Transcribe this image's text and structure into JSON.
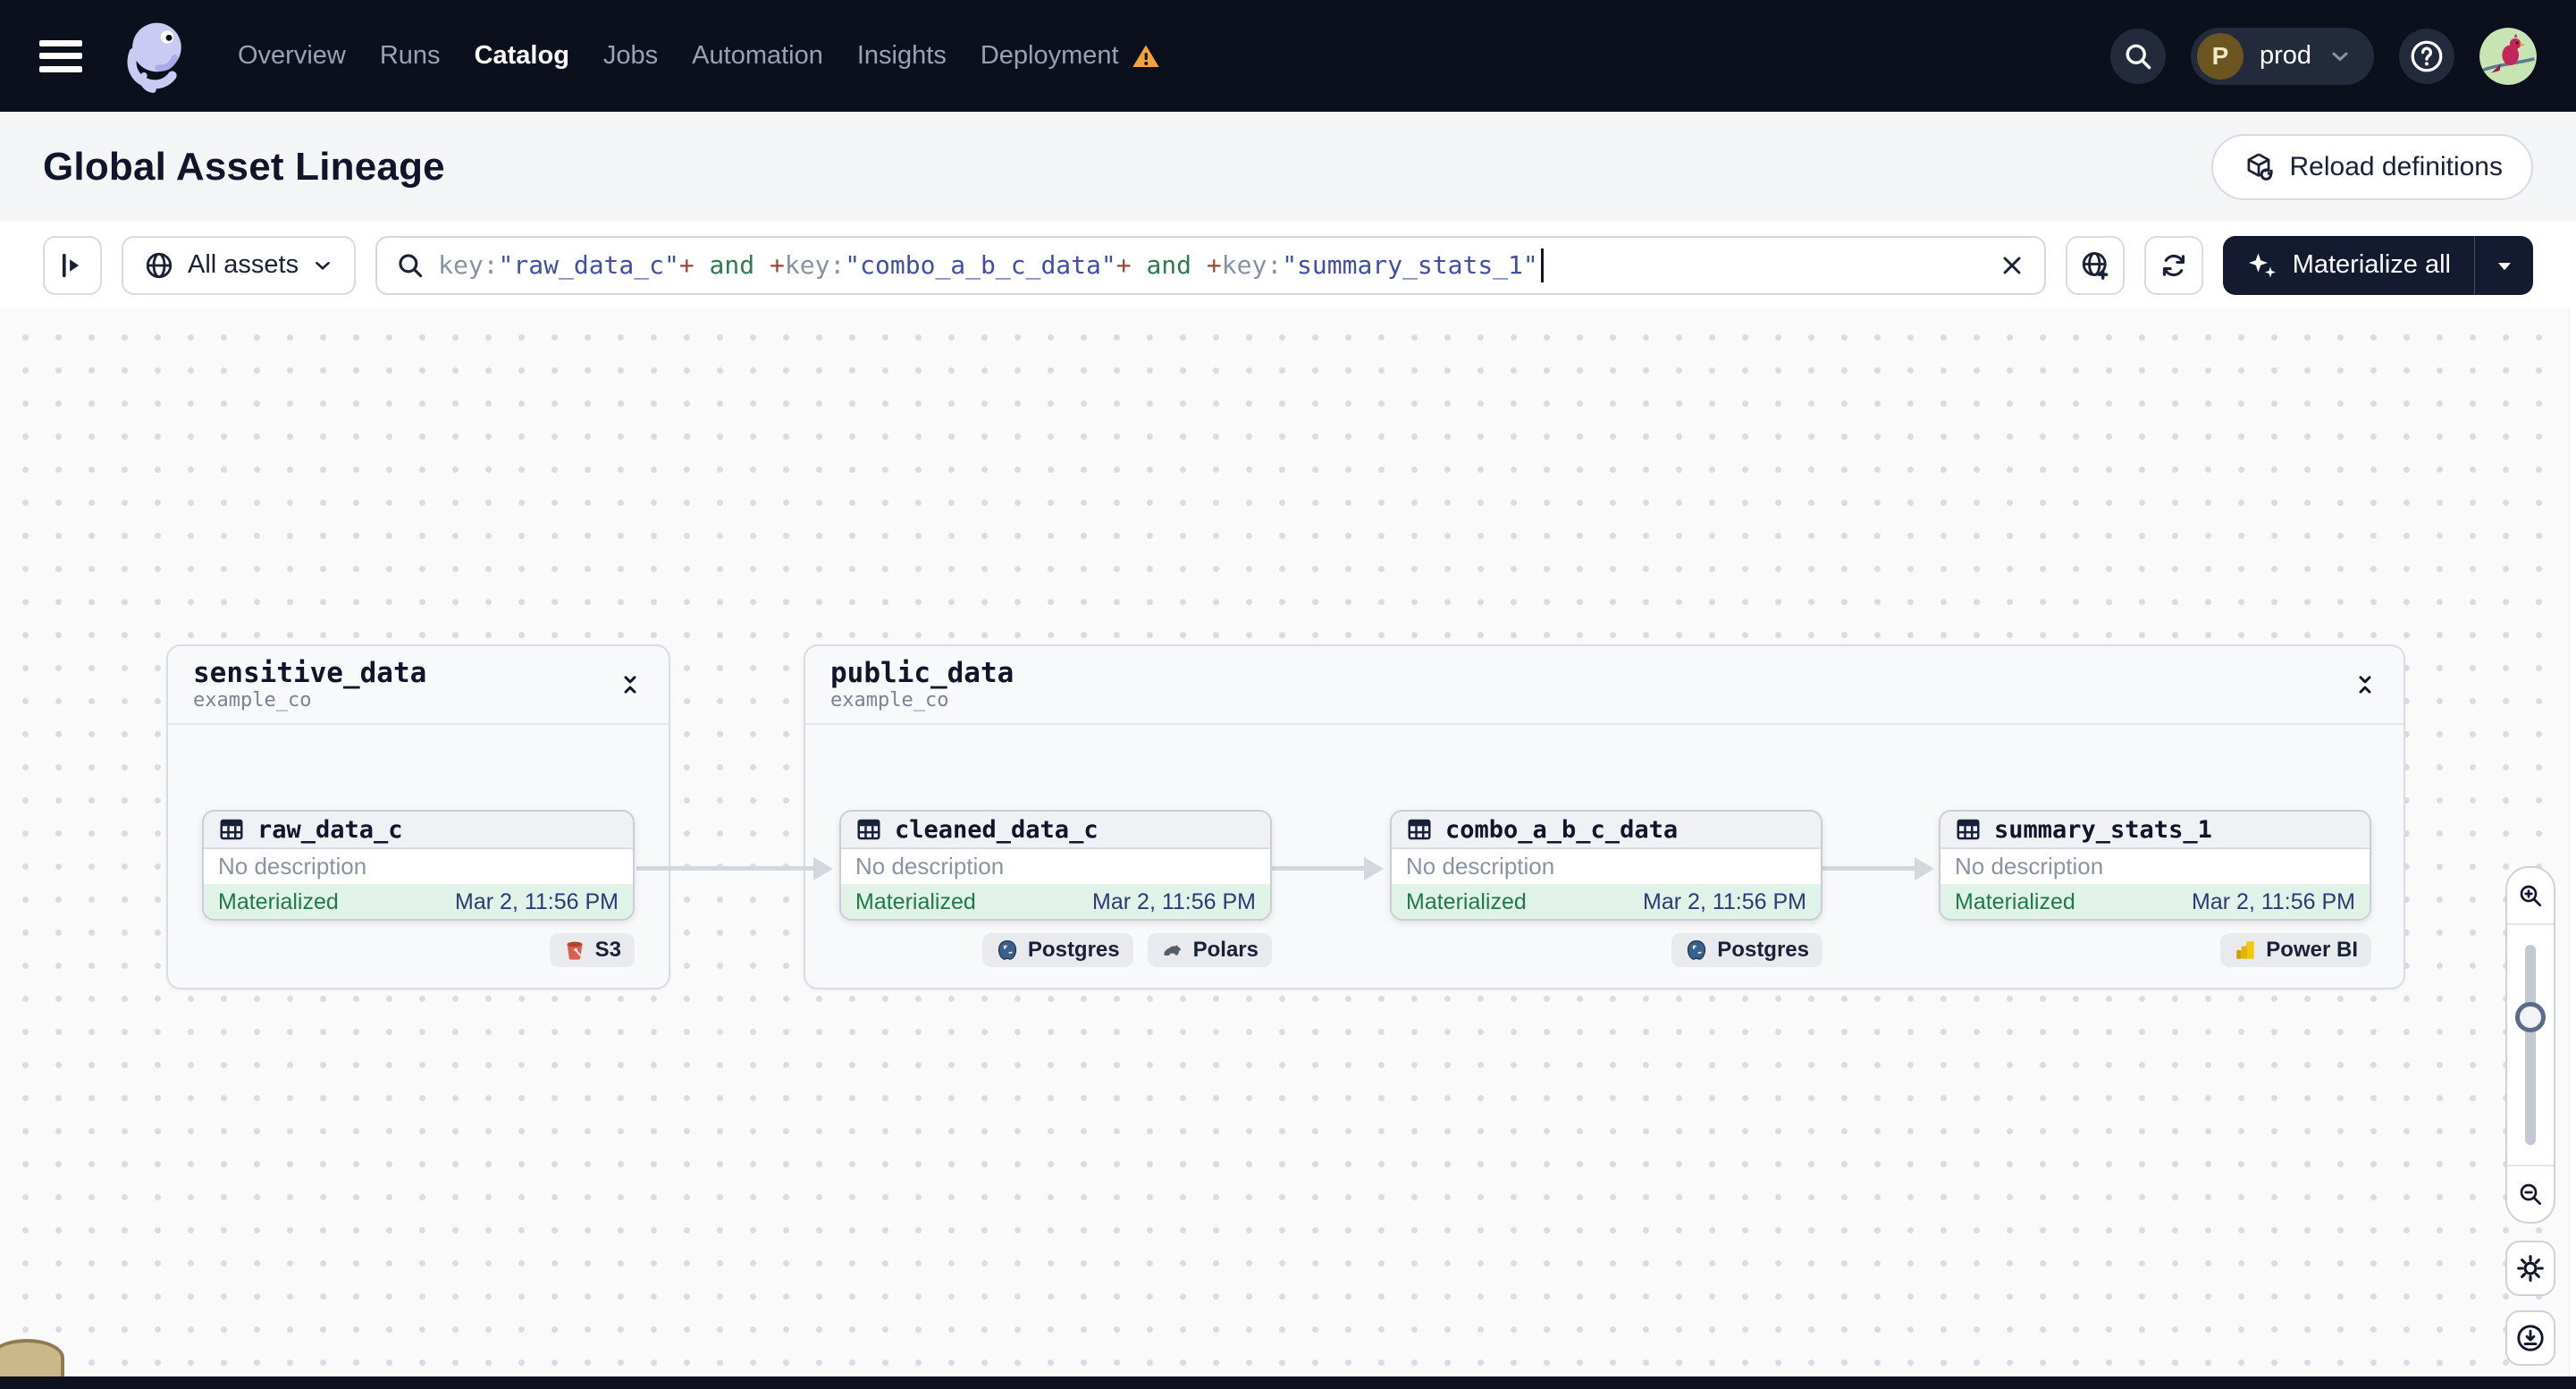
{
  "navbar": {
    "items": [
      {
        "label": "Overview"
      },
      {
        "label": "Runs"
      },
      {
        "label": "Catalog"
      },
      {
        "label": "Jobs"
      },
      {
        "label": "Automation"
      },
      {
        "label": "Insights"
      },
      {
        "label": "Deployment"
      }
    ],
    "environment": {
      "initial": "P",
      "name": "prod"
    }
  },
  "header": {
    "title": "Global Asset Lineage",
    "reload_label": "Reload definitions"
  },
  "toolbar": {
    "scope_label": "All assets",
    "materialize_label": "Materialize all",
    "query_tokens": [
      {
        "text": "key:",
        "type": "key"
      },
      {
        "text": "\"raw_data_c\"",
        "type": "value"
      },
      {
        "text": "+",
        "type": "op"
      },
      {
        "text": " and ",
        "type": "logic"
      },
      {
        "text": "+",
        "type": "op"
      },
      {
        "text": "key:",
        "type": "key"
      },
      {
        "text": "\"combo_a_b_c_data\"",
        "type": "value"
      },
      {
        "text": "+",
        "type": "op"
      },
      {
        "text": " and ",
        "type": "logic"
      },
      {
        "text": "+",
        "type": "op"
      },
      {
        "text": "key:",
        "type": "key"
      },
      {
        "text": "\"summary_stats_1\"",
        "type": "value"
      }
    ]
  },
  "graph": {
    "groups": [
      {
        "name": "sensitive_data",
        "location": "example_co"
      },
      {
        "name": "public_data",
        "location": "example_co"
      }
    ],
    "nodes": [
      {
        "name": "raw_data_c",
        "description": "No description",
        "status": "Materialized",
        "timestamp": "Mar 2, 11:56 PM",
        "tags": [
          {
            "label": "S3",
            "icon": "s3"
          }
        ]
      },
      {
        "name": "cleaned_data_c",
        "description": "No description",
        "status": "Materialized",
        "timestamp": "Mar 2, 11:56 PM",
        "tags": [
          {
            "label": "Postgres",
            "icon": "postgres"
          },
          {
            "label": "Polars",
            "icon": "polars"
          }
        ]
      },
      {
        "name": "combo_a_b_c_data",
        "description": "No description",
        "status": "Materialized",
        "timestamp": "Mar 2, 11:56 PM",
        "tags": [
          {
            "label": "Postgres",
            "icon": "postgres"
          }
        ]
      },
      {
        "name": "summary_stats_1",
        "description": "No description",
        "status": "Materialized",
        "timestamp": "Mar 2, 11:56 PM",
        "tags": [
          {
            "label": "Power BI",
            "icon": "powerbi"
          }
        ]
      }
    ]
  },
  "colors": {
    "nav_bg": "#0C101D",
    "warning": "#F2A33C",
    "status_green_bg": "#E1F3E8",
    "status_green_text": "#1E7A4A",
    "timestamp_navy": "#2B3A74",
    "materialize_bg": "#141A2F"
  }
}
